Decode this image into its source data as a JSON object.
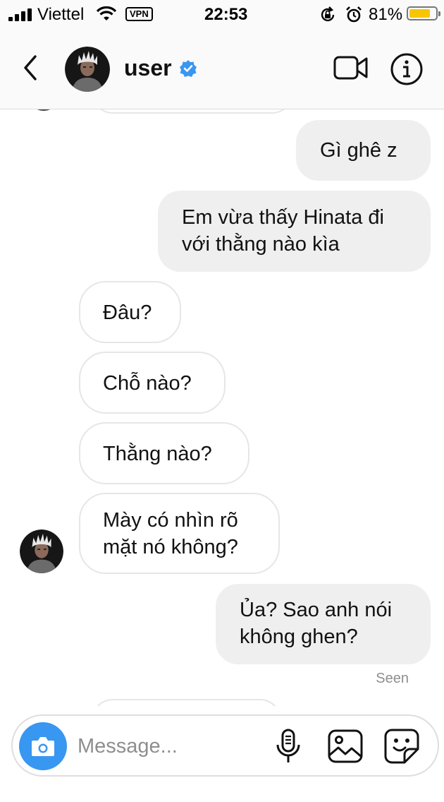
{
  "status_bar": {
    "carrier": "Viettel",
    "vpn_label": "VPN",
    "time": "22:53",
    "battery_percent_label": "81%",
    "battery_level": 0.81,
    "battery_color": "#f7c600"
  },
  "header": {
    "username": "user",
    "verified": true,
    "verified_color": "#3897f0",
    "icons": [
      "chevron-left-icon",
      "video-camera-icon",
      "info-icon"
    ]
  },
  "messages": [
    {
      "sender": "me",
      "text": "Gì ghê z"
    },
    {
      "sender": "me",
      "lines": [
        "Em vừa thấy Hinata đi",
        "với thằng nào kìa"
      ]
    },
    {
      "sender": "them",
      "text": "Đâu?"
    },
    {
      "sender": "them",
      "text": "Chỗ nào?"
    },
    {
      "sender": "them",
      "text": "Thằng nào?"
    },
    {
      "sender": "them",
      "lines": [
        "Mày có nhìn rõ",
        "mặt nó không?"
      ]
    },
    {
      "sender": "me",
      "lines": [
        "Ủa? Sao anh nói",
        "không ghen?"
      ]
    }
  ],
  "seen_label": "Seen",
  "composer": {
    "placeholder": "Message...",
    "camera_color": "#3897f0",
    "icons": [
      "camera-icon",
      "microphone-icon",
      "gallery-icon",
      "sticker-icon"
    ]
  }
}
